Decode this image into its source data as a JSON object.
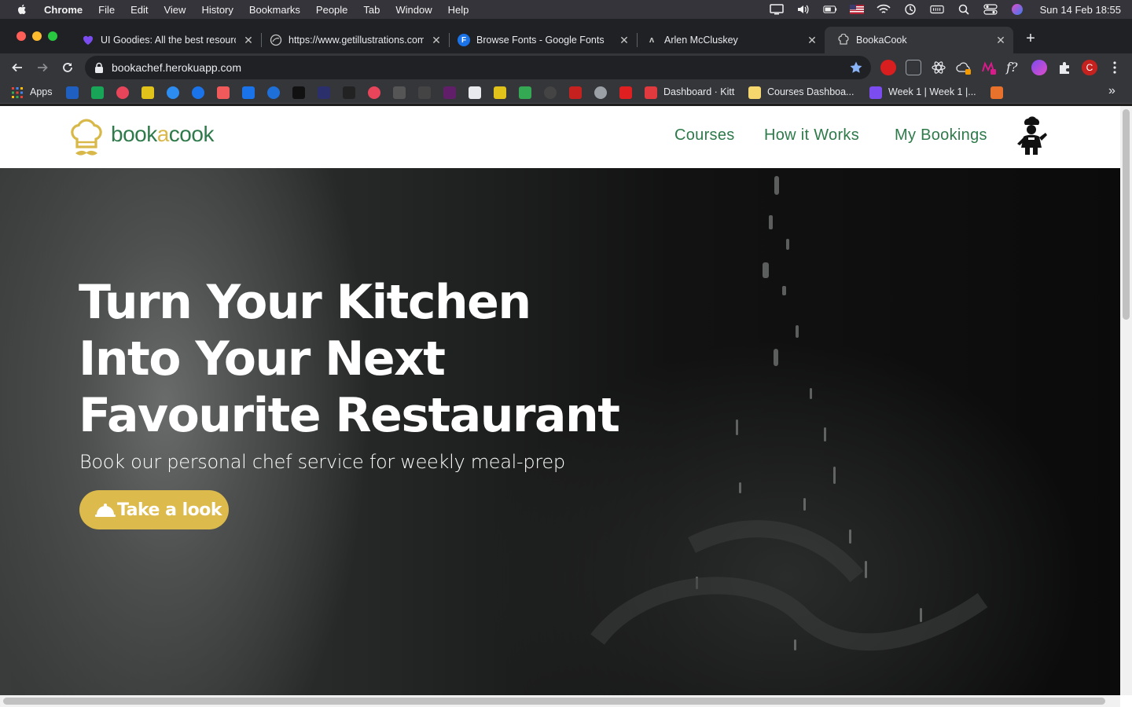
{
  "menubar": {
    "app_name": "Chrome",
    "items": [
      "File",
      "Edit",
      "View",
      "History",
      "Bookmarks",
      "People",
      "Tab",
      "Window",
      "Help"
    ],
    "clock": "Sun 14 Feb  18:55"
  },
  "tabs": [
    {
      "title": "UI Goodies: All the best resources",
      "favicon": "heart-icon",
      "color": "#7b4cf0"
    },
    {
      "title": "https://www.getillustrations.com",
      "favicon": "globe-icon",
      "color": "#202124"
    },
    {
      "title": "Browse Fonts - Google Fonts",
      "favicon": "fonts-icon",
      "color": "#1a73e8"
    },
    {
      "title": "Arlen McCluskey",
      "favicon": "pen-icon",
      "color": "#202124"
    },
    {
      "title": "BookaCook",
      "favicon": "chef-hat-icon",
      "color": "#35363a"
    }
  ],
  "address_bar": {
    "url": "bookachef.herokuapp.com"
  },
  "bookmarks": {
    "apps_label": "Apps",
    "dashboard_label": "Dashboard · Kitt",
    "courses_label": "Courses Dashboa...",
    "week_label": "Week 1 | Week 1 |...",
    "overflow": "»"
  },
  "site": {
    "logo": {
      "book": "book",
      "a": "a",
      "cook": "cook"
    },
    "nav": [
      "Courses",
      "How it Works",
      "My Bookings"
    ],
    "colors": {
      "brand_green": "#2e7a4a",
      "brand_gold": "#dcbb4c"
    }
  },
  "hero": {
    "headline_lines": [
      "Turn Your Kitchen",
      "Into Your Next",
      "Favourite Restaurant"
    ],
    "subline": "Book our personal chef service for weekly meal-prep",
    "cta_label": "Take a look"
  }
}
